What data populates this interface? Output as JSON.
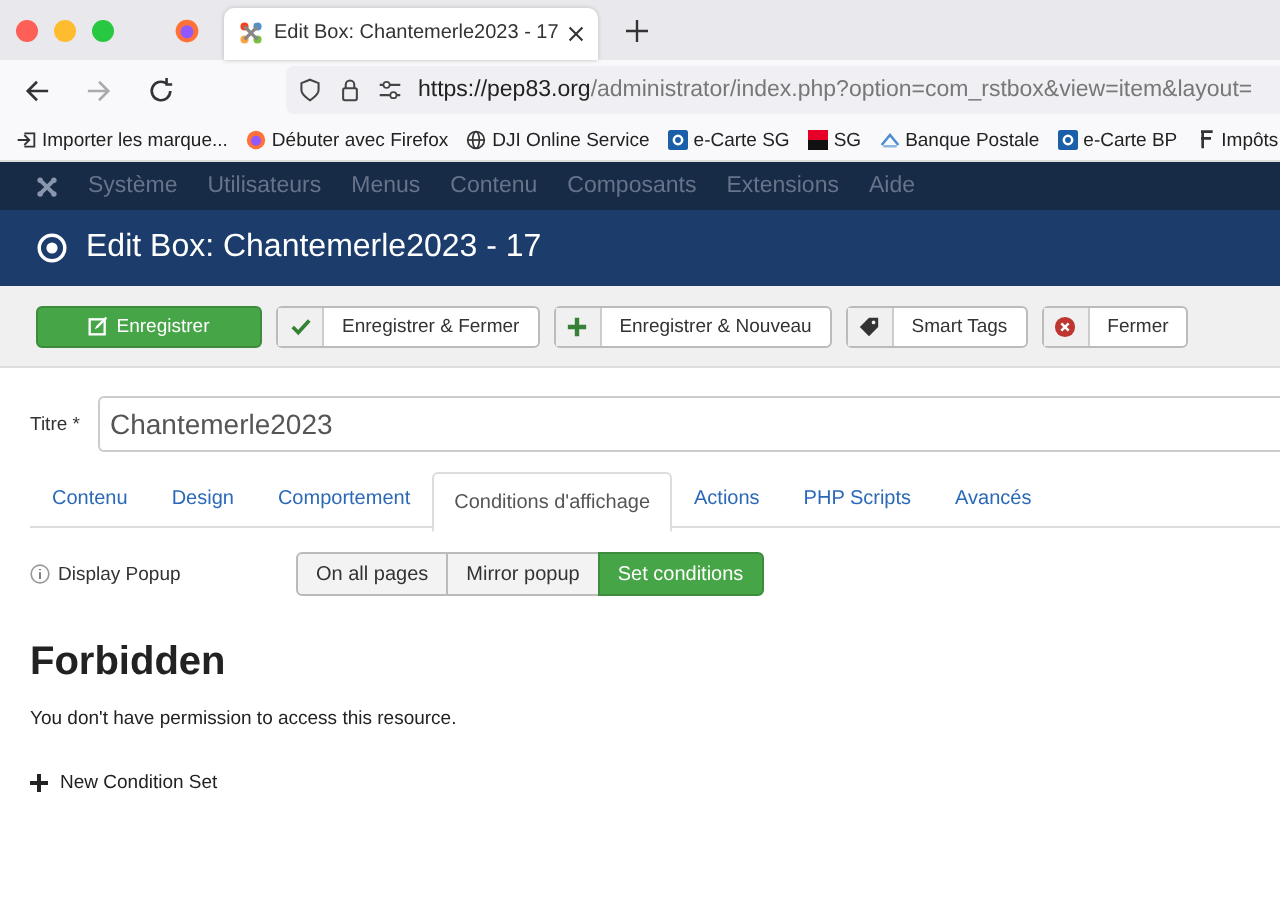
{
  "browser": {
    "tab_title": "Edit Box: Chantemerle2023 - 17",
    "url_host": "https://pep83.org",
    "url_path": "/administrator/index.php?option=com_rstbox&view=item&layout=",
    "bookmarks": [
      {
        "label": "Importer les marque...",
        "kind": "import"
      },
      {
        "label": "Débuter avec Firefox",
        "kind": "firefox"
      },
      {
        "label": "DJI Online Service",
        "kind": "globe"
      },
      {
        "label": "e-Carte SG",
        "kind": "ecarte"
      },
      {
        "label": "SG",
        "kind": "sg"
      },
      {
        "label": "Banque Postale",
        "kind": "bank"
      },
      {
        "label": "e-Carte BP",
        "kind": "ecarte"
      },
      {
        "label": "Impôts",
        "kind": "tax"
      }
    ]
  },
  "nav": {
    "items": [
      "Système",
      "Utilisateurs",
      "Menus",
      "Contenu",
      "Composants",
      "Extensions",
      "Aide"
    ]
  },
  "page_title": "Edit Box: Chantemerle2023 - 17",
  "toolbar": [
    {
      "label": "Enregistrer",
      "kind": "primary"
    },
    {
      "label": "Enregistrer & Fermer",
      "kind": "check"
    },
    {
      "label": "Enregistrer & Nouveau",
      "kind": "plus"
    },
    {
      "label": "Smart Tags",
      "kind": "tag"
    },
    {
      "label": "Fermer",
      "kind": "close"
    }
  ],
  "title_field": {
    "label": "Titre *",
    "value": "Chantemerle2023"
  },
  "tabs": [
    {
      "label": "Contenu",
      "selected": false
    },
    {
      "label": "Design",
      "selected": false
    },
    {
      "label": "Comportement",
      "selected": false
    },
    {
      "label": "Conditions d'affichage",
      "selected": true
    },
    {
      "label": "Actions",
      "selected": false
    },
    {
      "label": "PHP Scripts",
      "selected": false
    },
    {
      "label": "Avancés",
      "selected": false
    }
  ],
  "display_popup": {
    "label": "Display Popup",
    "options": [
      {
        "label": "On all pages",
        "selected": false
      },
      {
        "label": "Mirror popup",
        "selected": false
      },
      {
        "label": "Set conditions",
        "selected": true
      }
    ]
  },
  "error": {
    "heading": "Forbidden",
    "message": "You don't have permission to access this resource."
  },
  "new_condition": "New Condition Set"
}
